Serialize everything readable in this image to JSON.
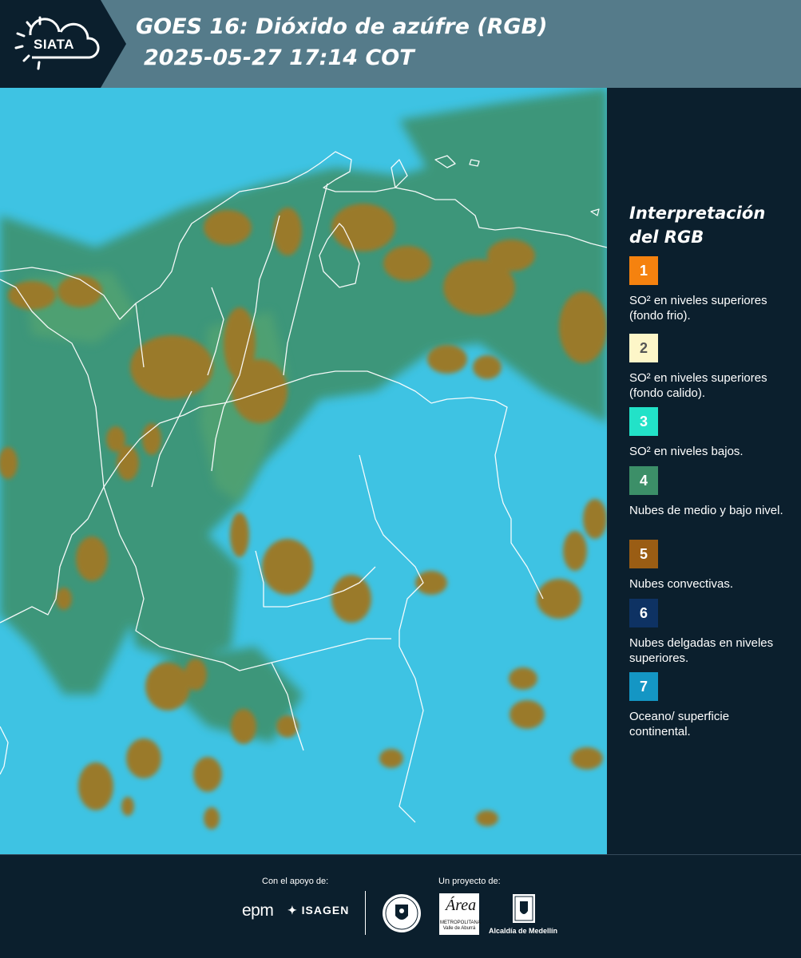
{
  "header": {
    "logo_text": "SIATA",
    "title_line1": "GOES 16: Dióxido de azúfre (RGB)",
    "title_line2": "2025-05-27 17:14 COT"
  },
  "legend": {
    "title": "Interpretación del RGB",
    "items": [
      {
        "number": "1",
        "color": "#f5820f",
        "text_color": "#ffffff",
        "label": "SO² en niveles superiores (fondo frio)."
      },
      {
        "number": "2",
        "color": "#fdf6c8",
        "text_color": "#555555",
        "label": "SO² en niveles superiores (fondo calido)."
      },
      {
        "number": "3",
        "color": "#22e2c8",
        "text_color": "#ffffff",
        "label": "SO² en niveles bajos."
      },
      {
        "number": "4",
        "color": "#3c8f68",
        "text_color": "#ffffff",
        "label": "Nubes de medio y bajo nivel."
      },
      {
        "number": "5",
        "color": "#9a5d14",
        "text_color": "#ffffff",
        "label": "Nubes convectivas."
      },
      {
        "number": "6",
        "color": "#0e3263",
        "text_color": "#ffffff",
        "label": "Nubes delgadas en niveles superiores."
      },
      {
        "number": "7",
        "color": "#1496c4",
        "text_color": "#ffffff",
        "label": "Oceano/ superficie continental."
      }
    ]
  },
  "footer": {
    "support_caption": "Con el apoyo de:",
    "project_caption": "Un proyecto de:",
    "epm": "epm",
    "isagen": "ISAGEN",
    "amva_letter": "Área",
    "amva_sub": "METROPOLITANA Valle de Aburrá",
    "alcaldia": "Alcaldía de Medellín"
  },
  "colors": {
    "ocean": "#3ec3e3",
    "land_low_cloud": "#3c8f68",
    "convective_cloud": "#9a7a2a",
    "header_bg": "#557b8a",
    "panel_bg": "#0b1f2d"
  }
}
